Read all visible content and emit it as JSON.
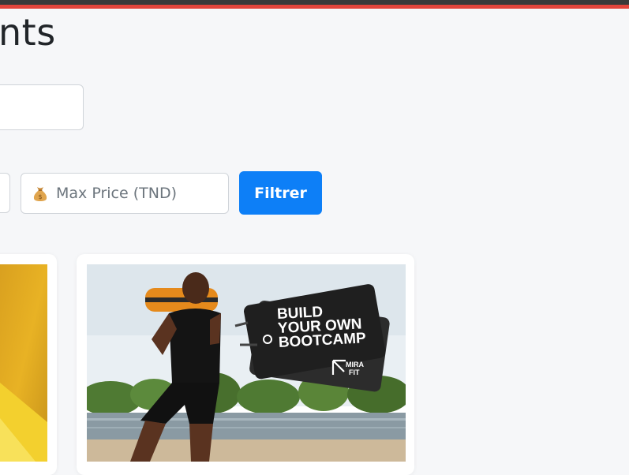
{
  "header": {
    "title": "nts"
  },
  "filters": {
    "search_value": "",
    "max_price_placeholder": "Max Price (TND)",
    "max_price_icon": "money-bag-icon",
    "filter_button_label": "Filtrer"
  },
  "products": [
    {
      "image": "yellow-product-image"
    },
    {
      "image": "bootcamp-banner-image",
      "banner_lines": [
        "BUILD",
        "YOUR OWN",
        "BOOTCAMP"
      ],
      "brand_lines": [
        "MIRA",
        "FIT"
      ]
    }
  ],
  "colors": {
    "accent_blue": "#0d7ff7",
    "top_bar_dark": "#3a3a3a",
    "top_bar_red": "#e2453c",
    "background": "#f6f7f9"
  }
}
